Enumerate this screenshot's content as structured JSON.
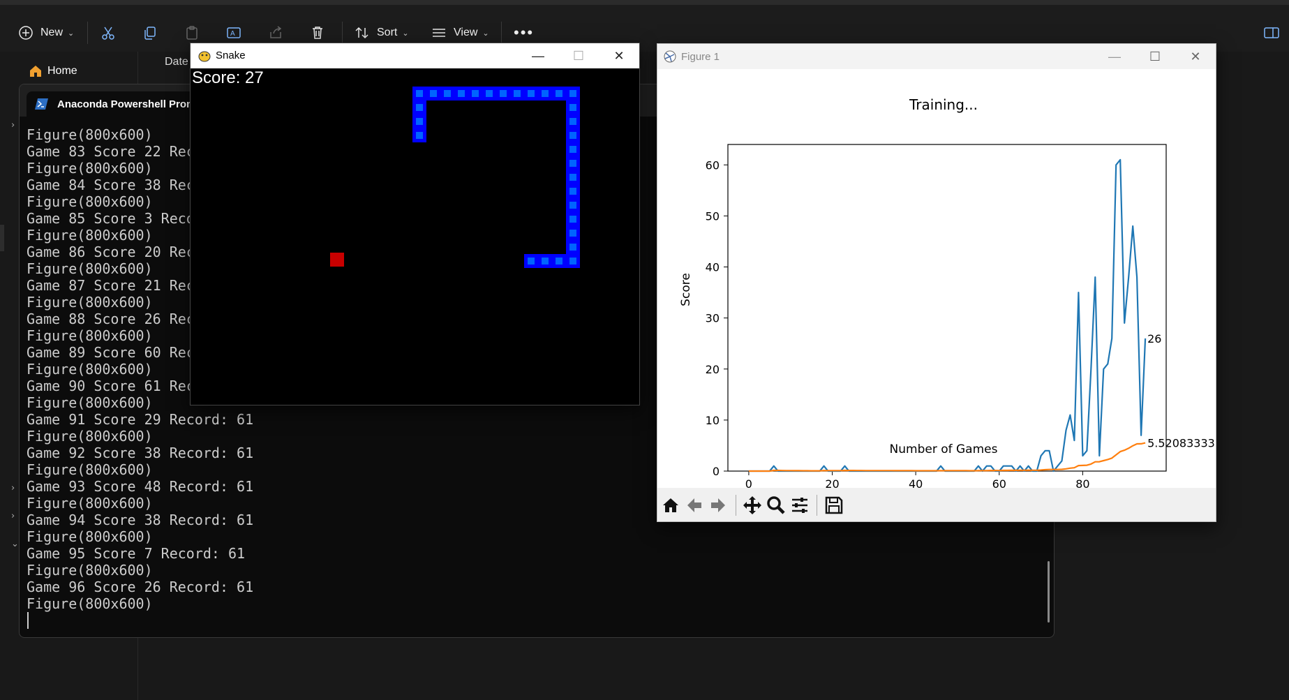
{
  "explorer": {
    "toolbar": {
      "new_label": "New",
      "sort_label": "Sort",
      "view_label": "View"
    },
    "nav": {
      "home_label": "Home"
    },
    "column_date": "Date"
  },
  "terminal": {
    "tab_title": "Anaconda Powershell Prom",
    "lines": [
      "Figure(800x600)",
      "Game 83 Score 22 Rec",
      "Figure(800x600)",
      "Game 84 Score 38 Rec",
      "Figure(800x600)",
      "Game 85 Score 3 Reco",
      "Figure(800x600)",
      "Game 86 Score 20 Rec",
      "Figure(800x600)",
      "Game 87 Score 21 Rec",
      "Figure(800x600)",
      "Game 88 Score 26 Rec",
      "Figure(800x600)",
      "Game 89 Score 60 Rec",
      "Figure(800x600)",
      "Game 90 Score 61 Rec",
      "Figure(800x600)",
      "Game 91 Score 29 Record: 61",
      "Figure(800x600)",
      "Game 92 Score 38 Record: 61",
      "Figure(800x600)",
      "Game 93 Score 48 Record: 61",
      "Figure(800x600)",
      "Game 94 Score 38 Record: 61",
      "Figure(800x600)",
      "Game 95 Score 7 Record: 61",
      "Figure(800x600)",
      "Game 96 Score 26 Record: 61",
      "Figure(800x600)"
    ]
  },
  "snake_window": {
    "title": "Snake",
    "score_text": "Score: 27",
    "snake_color": "#0000ff",
    "snake_inner_color": "#0064ff",
    "food_color": "#c80000"
  },
  "figure_window": {
    "title": "Figure 1"
  },
  "chart_data": {
    "type": "line",
    "title": "Training...",
    "xlabel": "Number of Games",
    "ylabel": "Score",
    "xlim": [
      -5,
      100
    ],
    "ylim": [
      0,
      64
    ],
    "xticks": [
      0,
      20,
      40,
      60,
      80
    ],
    "yticks": [
      0,
      10,
      20,
      30,
      40,
      50,
      60
    ],
    "series": [
      {
        "color": "#1f77b4",
        "values": [
          0,
          0,
          0,
          0,
          0,
          0,
          1,
          0,
          0,
          0,
          0,
          0,
          0,
          0,
          0,
          0,
          0,
          0,
          1,
          0,
          0,
          0,
          0,
          1,
          0,
          0,
          0,
          0,
          0,
          0,
          0,
          0,
          0,
          0,
          0,
          0,
          0,
          0,
          0,
          0,
          0,
          0,
          0,
          0,
          0,
          0,
          1,
          0,
          0,
          0,
          0,
          0,
          0,
          0,
          0,
          1,
          0,
          1,
          1,
          0,
          0,
          1,
          1,
          1,
          0,
          1,
          0,
          1,
          0,
          0,
          3,
          4,
          4,
          0,
          1,
          2,
          8,
          11,
          6,
          35,
          3,
          4,
          20,
          38,
          3,
          20,
          21,
          26,
          60,
          61,
          29,
          38,
          48,
          38,
          7,
          26
        ],
        "end_label": "26"
      },
      {
        "color": "#ff7f0e",
        "values": [
          0,
          0,
          0,
          0,
          0,
          0,
          0.14,
          0.13,
          0.11,
          0.1,
          0.09,
          0.08,
          0.08,
          0.07,
          0.07,
          0.06,
          0.06,
          0.06,
          0.11,
          0.1,
          0.1,
          0.09,
          0.09,
          0.13,
          0.12,
          0.12,
          0.11,
          0.11,
          0.1,
          0.1,
          0.1,
          0.09,
          0.09,
          0.09,
          0.09,
          0.08,
          0.08,
          0.08,
          0.08,
          0.08,
          0.07,
          0.07,
          0.07,
          0.07,
          0.07,
          0.07,
          0.09,
          0.08,
          0.08,
          0.08,
          0.08,
          0.08,
          0.08,
          0.07,
          0.07,
          0.09,
          0.09,
          0.1,
          0.12,
          0.12,
          0.11,
          0.13,
          0.14,
          0.16,
          0.15,
          0.17,
          0.16,
          0.18,
          0.17,
          0.17,
          0.21,
          0.27,
          0.32,
          0.32,
          0.32,
          0.34,
          0.44,
          0.58,
          0.65,
          1.08,
          1.11,
          1.15,
          1.38,
          1.82,
          1.83,
          2.05,
          2.27,
          2.54,
          3.18,
          3.81,
          4.09,
          4.47,
          4.97,
          5.33,
          5.35,
          5.52
        ],
        "end_label": "5.520833333"
      }
    ]
  }
}
